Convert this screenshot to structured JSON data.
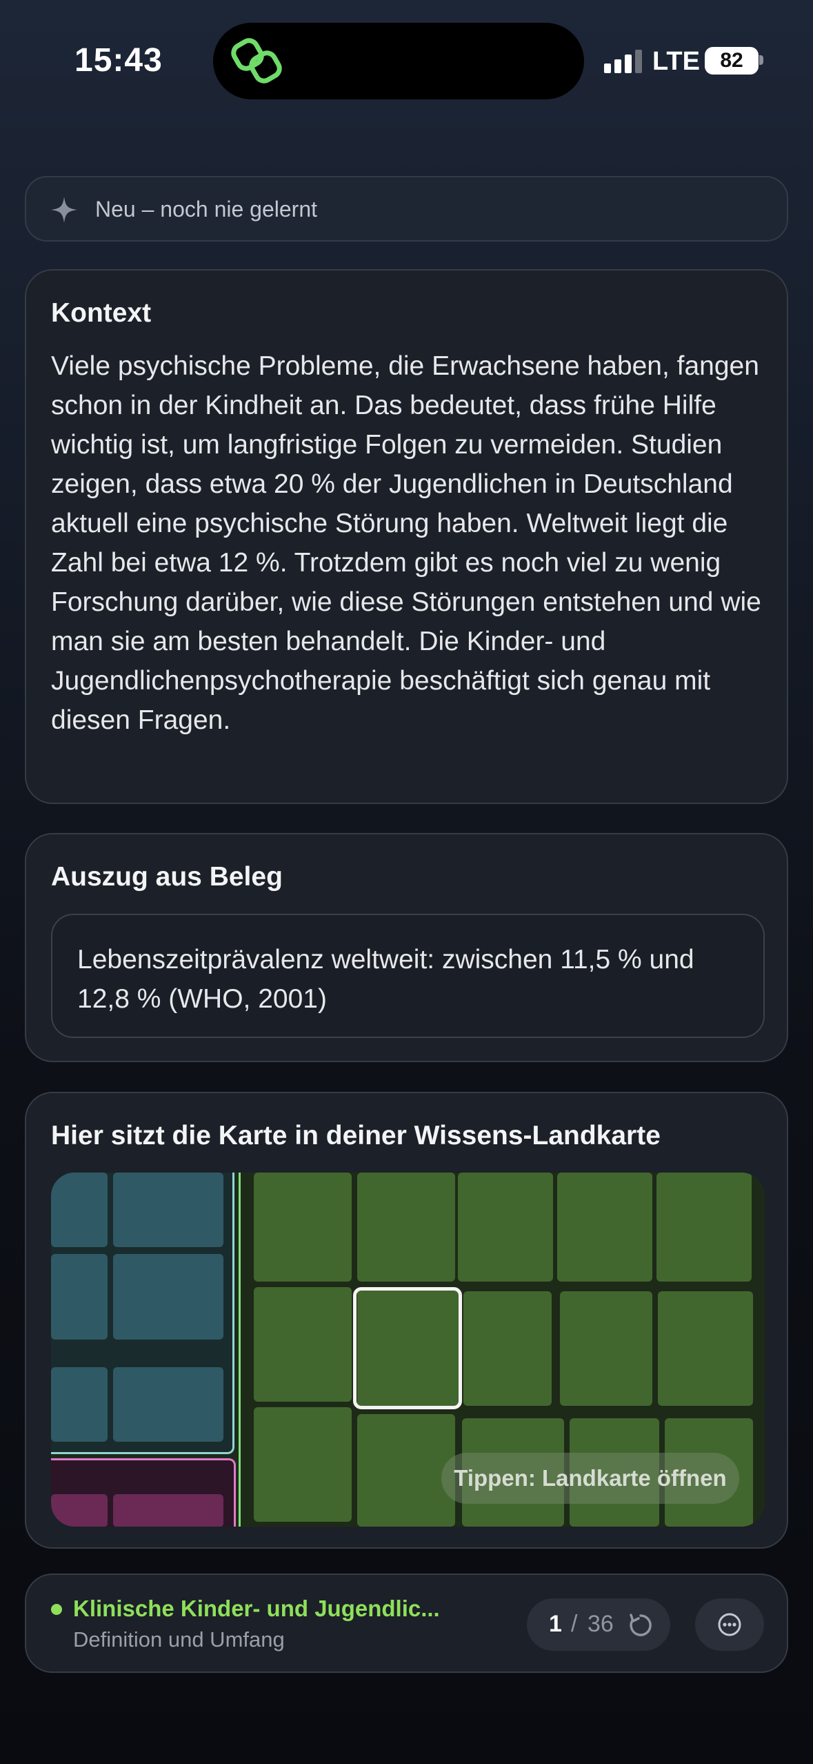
{
  "status": {
    "time": "15:43",
    "network": "LTE",
    "battery": "82"
  },
  "learn_state": {
    "label": "Neu – noch nie gelernt",
    "icon": "sparkle-icon"
  },
  "context": {
    "title": "Kontext",
    "body": "Viele psychische Probleme, die Erwachsene haben, fangen schon in der Kindheit an. Das bedeutet, dass frühe Hilfe wichtig ist, um langfristige Folgen zu vermeiden. Studien zeigen, dass etwa 20 % der Jugendlichen in Deutschland aktuell eine psychische Störung haben. Weltweit liegt die Zahl bei etwa 12 %. Trotzdem gibt es noch viel zu wenig Forschung darüber, wie diese Störungen entstehen und wie man sie am besten behandelt. Die Kinder- und Jugendlichenpsychotherapie beschäftigt sich genau mit diesen Fragen."
  },
  "excerpt": {
    "title": "Auszug aus Beleg",
    "quote": "Lebenszeitprävalenz weltweit: zwischen 11,5 % und 12,8 % (WHO, 2001)"
  },
  "knowledge_map": {
    "title": "Hier sitzt die Karte in deiner Wissens-Landkarte",
    "hint": "Tippen: Landkarte öffnen",
    "colors": {
      "teal": "#2f5a65",
      "green": "#42672e",
      "magenta": "#6a2a55",
      "selection": "#f4f4f2"
    }
  },
  "deck": {
    "name": "Klinische Kinder- und Jugendlic...",
    "subtitle": "Definition und Umfang",
    "current": "1",
    "separator": "/",
    "total": "36",
    "accent": "#8ee05a"
  }
}
